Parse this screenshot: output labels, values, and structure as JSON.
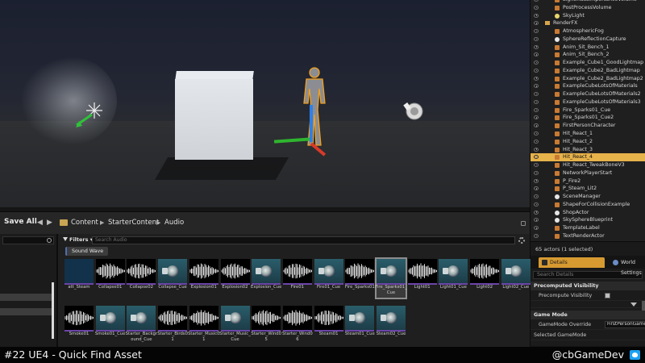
{
  "outliner": {
    "rows": [
      {
        "label": "LightmassImportanceVolume",
        "indent": 30,
        "icon": "box"
      },
      {
        "label": "PostProcessVolume",
        "indent": 30,
        "icon": "box"
      },
      {
        "label": "SkyLight",
        "indent": 30,
        "icon": "light"
      },
      {
        "label": "RenderFX",
        "indent": 18,
        "icon": "folder"
      },
      {
        "label": "AtmosphericFog",
        "indent": 30,
        "icon": "box"
      },
      {
        "label": "SphereReflectionCapture",
        "indent": 30,
        "icon": "sphere"
      },
      {
        "label": "Anim_Sit_Bench_1",
        "indent": 30,
        "icon": "box"
      },
      {
        "label": "Anim_Sit_Bench_2",
        "indent": 30,
        "icon": "box"
      },
      {
        "label": "Example_Cube1_GoodLightmap",
        "indent": 30,
        "icon": "box"
      },
      {
        "label": "Example_Cube2_BadLightmap",
        "indent": 30,
        "icon": "box"
      },
      {
        "label": "Example_Cube2_BadLightmap2",
        "indent": 30,
        "icon": "box"
      },
      {
        "label": "ExampleCubeLotsOfMaterials",
        "indent": 30,
        "icon": "box"
      },
      {
        "label": "ExampleCubeLotsOfMaterials2",
        "indent": 30,
        "icon": "box"
      },
      {
        "label": "ExampleCubeLotsOfMaterials3",
        "indent": 30,
        "icon": "box"
      },
      {
        "label": "Fire_Sparks01_Cue",
        "indent": 30,
        "icon": "box"
      },
      {
        "label": "Fire_Sparks01_Cue2",
        "indent": 30,
        "icon": "box"
      },
      {
        "label": "FirstPersonCharacter",
        "indent": 30,
        "icon": "box"
      },
      {
        "label": "Hit_React_1",
        "indent": 30,
        "icon": "box"
      },
      {
        "label": "Hit_React_2",
        "indent": 30,
        "icon": "box"
      },
      {
        "label": "Hit_React_3",
        "indent": 30,
        "icon": "box"
      },
      {
        "label": "Hit_React_4",
        "indent": 30,
        "icon": "box",
        "selected": true
      },
      {
        "label": "Hit_React_TweakBoneV3",
        "indent": 30,
        "icon": "box"
      },
      {
        "label": "NetworkPlayerStart",
        "indent": 30,
        "icon": "box"
      },
      {
        "label": "P_Fire2",
        "indent": 30,
        "icon": "box"
      },
      {
        "label": "P_Steam_Lit2",
        "indent": 30,
        "icon": "box"
      },
      {
        "label": "SceneManager",
        "indent": 30,
        "icon": "sphere"
      },
      {
        "label": "ShapeForCollisionExample",
        "indent": 30,
        "icon": "box"
      },
      {
        "label": "ShopActor",
        "indent": 30,
        "icon": "sphere"
      },
      {
        "label": "SkySphereBlueprint",
        "indent": 30,
        "icon": "sphere"
      },
      {
        "label": "TemplateLabel",
        "indent": 30,
        "icon": "box"
      },
      {
        "label": "TextRenderActor",
        "indent": 30,
        "icon": "box"
      }
    ],
    "status": "65 actors (1 selected)"
  },
  "details": {
    "tab_details": "Details",
    "tab_world": "World Settings",
    "search_placeholder": "Search Details",
    "cat_precomputed": "Precomputed Visibility",
    "prop_precompute": "Precompute Visibility",
    "cat_gamemode": "Game Mode",
    "prop_override": "GameMode Override",
    "override_value": "FirstPersonGameMode",
    "prop_selected": "Selected GameMode"
  },
  "content_browser": {
    "save_all": "Save All",
    "breadcrumb": [
      "Content",
      "StarterContent",
      "Audio"
    ],
    "filters_label": "Filters",
    "search_placeholder": "Search Audio",
    "filter_chip": "Sound Wave",
    "assets": [
      {
        "name": "att_Steam",
        "kind": "sw"
      },
      {
        "name": "Collapse01",
        "kind": "wave"
      },
      {
        "name": "Collapse02",
        "kind": "wave"
      },
      {
        "name": "Collapse_Cue",
        "kind": "cue"
      },
      {
        "name": "Explosion01",
        "kind": "wave"
      },
      {
        "name": "Explosion02",
        "kind": "wave"
      },
      {
        "name": "Explosion_Cue",
        "kind": "cue"
      },
      {
        "name": "Fire01",
        "kind": "wave"
      },
      {
        "name": "Fire01_Cue",
        "kind": "cue"
      },
      {
        "name": "Fire_Sparks01",
        "kind": "wave"
      },
      {
        "name": "Fire_Sparks01_Cue",
        "kind": "cue",
        "selected": true
      },
      {
        "name": "Light01",
        "kind": "wave"
      },
      {
        "name": "Light01_Cue",
        "kind": "cue"
      },
      {
        "name": "Light02",
        "kind": "wave"
      },
      {
        "name": "Light02_Cue",
        "kind": "cue"
      },
      {
        "name": "Smoke01",
        "kind": "wave"
      },
      {
        "name": "Smoke01_Cue",
        "kind": "cue"
      },
      {
        "name": "Starter_Background_Cue",
        "kind": "cue"
      },
      {
        "name": "Starter_Birds01",
        "kind": "wave"
      },
      {
        "name": "Starter_Music01",
        "kind": "wave"
      },
      {
        "name": "Starter_Music_Cue",
        "kind": "cue"
      },
      {
        "name": "Starter_Wind05",
        "kind": "wave"
      },
      {
        "name": "Starter_Wind06",
        "kind": "wave"
      },
      {
        "name": "Steam01",
        "kind": "wave"
      },
      {
        "name": "Steam01_Cue",
        "kind": "cue"
      },
      {
        "name": "Steam02_Cue",
        "kind": "cue"
      }
    ]
  },
  "banner": {
    "title": "#22 UE4 - Quick Find Asset",
    "handle": "@cbGameDev"
  },
  "colors": {
    "selection": "#e6b24a",
    "details_tab": "#d69a31",
    "sound_wave_bar": "#6b45a8",
    "cue_thumb": "#2a5d6a"
  }
}
